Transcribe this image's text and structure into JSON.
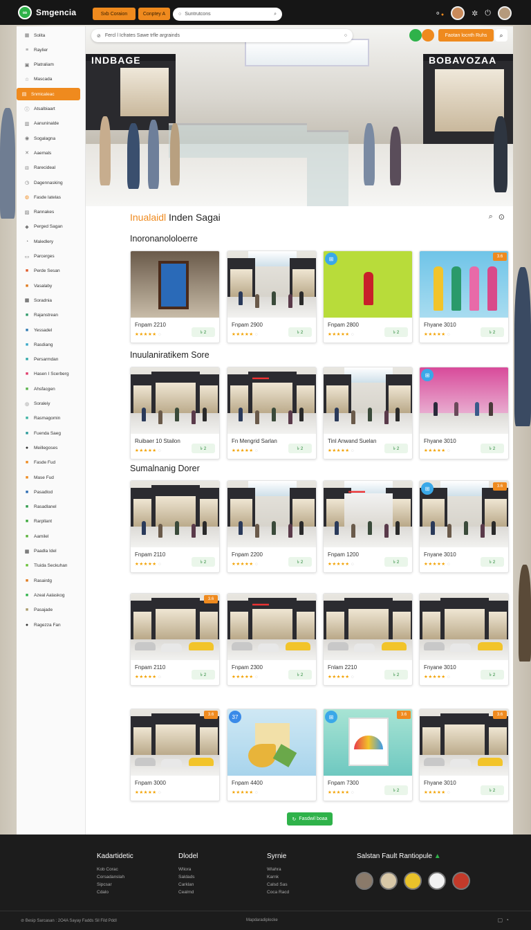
{
  "app": {
    "name": "Smgencia",
    "logo_glyph": "∞",
    "accent": "#ef8a1e",
    "brand_green": "#2fb24a"
  },
  "topbar": {
    "btn1": "Sxb Coraion",
    "btn2": "Conptey A",
    "search_placeholder": "Suntrutcons",
    "icons": [
      "notification-icon",
      "settings-icon",
      "power-icon"
    ]
  },
  "hero": {
    "search_placeholder": "Fercl l Icfrates Sawe trfle argrainds",
    "cta": "Faotan locnth Ruhs",
    "store_left": "INDBAGE",
    "store_right": "BOBAVOZAA"
  },
  "sidebar": {
    "items": [
      {
        "label": "Solita",
        "icon": "grid-icon"
      },
      {
        "label": "Raylier",
        "icon": "menu-icon"
      },
      {
        "label": "Platraliam",
        "icon": "image-icon"
      },
      {
        "label": "Mascada",
        "icon": "star-icon"
      },
      {
        "label": "Snmicaleac",
        "icon": "store-icon"
      },
      {
        "label": "Atsalbiaart",
        "icon": "info-icon"
      },
      {
        "label": "Aanuninalde",
        "icon": "document-icon"
      },
      {
        "label": "Sogalagna",
        "icon": "coin-icon"
      },
      {
        "label": "Aaemals",
        "icon": "cross-icon"
      },
      {
        "label": "Rarecideal",
        "icon": "cart-icon"
      },
      {
        "label": "Dagennasking",
        "icon": "clock-icon"
      },
      {
        "label": "Fasde Iatelas",
        "icon": "badge-icon"
      },
      {
        "label": "Rannakes",
        "icon": "building-icon"
      },
      {
        "label": "Perged Sagan",
        "icon": "tag-icon"
      },
      {
        "label": "Maledlery",
        "icon": "timer-icon"
      },
      {
        "label": "Parcerges",
        "icon": "file-icon"
      },
      {
        "label": "Perde Sesan",
        "icon": "red-tag-icon"
      },
      {
        "label": "Vasalaby",
        "icon": "chart-icon"
      },
      {
        "label": "Soradnia",
        "icon": "apps-icon"
      },
      {
        "label": "Rajanstrean",
        "icon": "calendar-icon"
      },
      {
        "label": "Yessadel",
        "icon": "send-icon"
      },
      {
        "label": "Rasdiang",
        "icon": "cyan-icon"
      },
      {
        "label": "Persarmdan",
        "icon": "ticket-icon"
      },
      {
        "label": "Hasen I Scerberg",
        "icon": "pink-icon"
      },
      {
        "label": "Ahsfacgen",
        "icon": "arrow-icon"
      },
      {
        "label": "Soraleiy",
        "icon": "globe-icon"
      },
      {
        "label": "Rasmagomin",
        "icon": "check-icon"
      },
      {
        "label": "Fuenda Saeg",
        "icon": "teal-icon"
      },
      {
        "label": "Meillegoses",
        "icon": "dark-icon"
      },
      {
        "label": "Fasde Fud",
        "icon": "orange-icon"
      },
      {
        "label": "Mase Fud",
        "icon": "orange2-icon"
      },
      {
        "label": "Pasadlod",
        "icon": "blue-icon"
      },
      {
        "label": "Rasadlanel",
        "icon": "green-icon"
      },
      {
        "label": "Rarpllant",
        "icon": "green2-icon"
      },
      {
        "label": "Aamilel",
        "icon": "green3-icon"
      },
      {
        "label": "Paadla Idel",
        "icon": "qr-icon"
      },
      {
        "label": "Tluida Seckuhan",
        "icon": "lime-icon"
      },
      {
        "label": "Rasairdg",
        "icon": "amber-icon"
      },
      {
        "label": "Azeal Aalaskog",
        "icon": "green4-icon"
      },
      {
        "label": "Pasajade",
        "icon": "sand-icon"
      },
      {
        "label": "Ragezza Fan",
        "icon": "dark2-icon"
      }
    ]
  },
  "main": {
    "title_accent": "Inualaidl",
    "title_rest": " Inden Sagai",
    "sections": [
      {
        "title": "Inoronanololoerre",
        "cards": [
          {
            "name": "Fnpam 2210",
            "price": "৳ 2",
            "scene": "kiosk"
          },
          {
            "name": "Fnpam 2900",
            "price": "৳ 2",
            "scene": "mall"
          },
          {
            "name": "Fnpam 2800",
            "price": "৳ 2",
            "scene": "green",
            "badge_c": "⊞"
          },
          {
            "name": "Fhyane 3010",
            "price": "৳ 2",
            "scene": "mannequins",
            "badge": "3.6"
          }
        ]
      },
      {
        "title": "Inuulaniratikem Sore",
        "cards": [
          {
            "name": "Ruibaer 10 Stailon",
            "price": "৳ 2",
            "scene": "store"
          },
          {
            "name": "Fn Mengrid Sarlan",
            "price": "৳ 2",
            "scene": "store",
            "sign": "INDBAGE"
          },
          {
            "name": "Tinl Anwand Suelan",
            "price": "৳ 2",
            "scene": "mall"
          },
          {
            "name": "Fhyane 3010",
            "price": "৳ 2",
            "scene": "pink",
            "badge_c": "⊞"
          }
        ]
      },
      {
        "title": "Sumalnanig Dorer",
        "cards": [
          {
            "name": "Fnpam 2110",
            "price": "৳ 2",
            "scene": "store"
          },
          {
            "name": "Fnpam 2200",
            "price": "৳ 2",
            "scene": "mall"
          },
          {
            "name": "Fnpam 1200",
            "price": "৳ 2",
            "scene": "boutique",
            "sign": "INDBAGE"
          },
          {
            "name": "Fnyane 3010",
            "price": "৳ 2",
            "scene": "mall",
            "badge_c": "⊞",
            "badge": "3.6"
          }
        ]
      },
      {
        "title": "",
        "cards": [
          {
            "name": "Fnpam 2110",
            "price": "৳ 2",
            "scene": "parking",
            "badge": "3.6"
          },
          {
            "name": "Fnpam 2300",
            "price": "৳ 2",
            "scene": "parking",
            "sign": "INDBAGE"
          },
          {
            "name": "Fnlam 2210",
            "price": "৳ 2",
            "scene": "parking"
          },
          {
            "name": "Fnyane 3010",
            "price": "৳ 2",
            "scene": "parking"
          }
        ]
      },
      {
        "title": "",
        "cards": [
          {
            "name": "Fnpam 3000",
            "price": "",
            "scene": "parking",
            "badge": "3.6"
          },
          {
            "name": "Fnpam 4400",
            "price": "",
            "scene": "illustration",
            "badge_c": "37"
          },
          {
            "name": "Fnpam 7300",
            "price": "৳ 2",
            "scene": "illustration2",
            "badge_c": "⊞",
            "badge": "3.6"
          },
          {
            "name": "Fhyane 3010",
            "price": "৳ 2",
            "scene": "parking",
            "badge": "3.6"
          }
        ]
      }
    ],
    "load_more": "Fasdwil boaa"
  },
  "footer": {
    "columns": [
      {
        "head": "Kadartidetic",
        "links": [
          "Kob Corac",
          "Corsadanslah",
          "Sipcsar",
          "Cdalo"
        ]
      },
      {
        "head": "Dlodel",
        "links": [
          "Wliora",
          "Saldads",
          "Carklan",
          "Cealmd"
        ]
      },
      {
        "head": "Syrnie",
        "links": [
          "Wlahra",
          "Karnk",
          "Calsd Sas",
          "Coca Racd"
        ]
      }
    ],
    "social_title": "Salstan Fault Rantiopule",
    "bottom_left": "Besip Sarcasan : 2O4A Sayay Fadds Sil Fild Pddl",
    "bottom_center": "Mapdaradiplocke"
  }
}
